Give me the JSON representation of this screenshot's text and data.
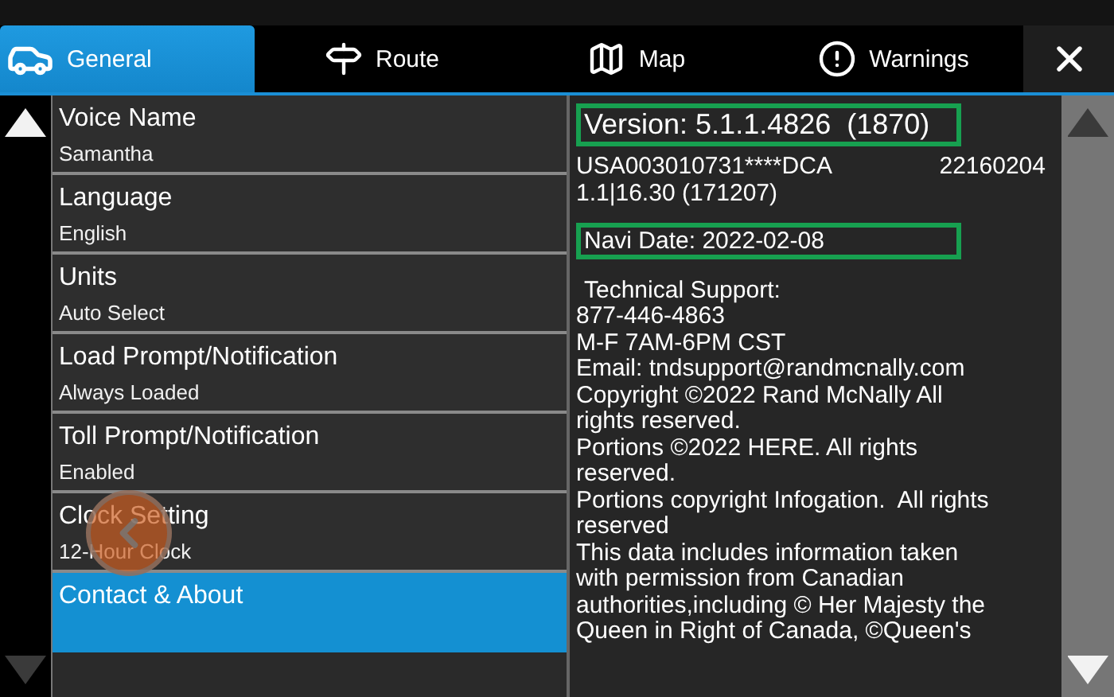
{
  "tabs": [
    {
      "label": "General",
      "kind": "car",
      "selected": true
    },
    {
      "label": "Route",
      "kind": "signpost",
      "selected": false
    },
    {
      "label": "Map",
      "kind": "map",
      "selected": false
    },
    {
      "label": "Warnings",
      "kind": "alert",
      "selected": false
    }
  ],
  "settings_scroll": {
    "up_disabled": false,
    "down_disabled": true
  },
  "settings": [
    {
      "title": "Voice Name",
      "value": "Samantha",
      "selected": false
    },
    {
      "title": "Language",
      "value": "English",
      "selected": false
    },
    {
      "title": "Units",
      "value": "Auto Select",
      "selected": false
    },
    {
      "title": "Load Prompt/Notification",
      "value": "Always Loaded",
      "selected": false
    },
    {
      "title": "Toll Prompt/Notification",
      "value": "Enabled",
      "selected": false
    },
    {
      "title": "Clock Setting",
      "value": "12-Hour Clock",
      "selected": false
    },
    {
      "title": "Contact & About",
      "selected": true
    }
  ],
  "about": {
    "version": {
      "text": "Version: 5.1.1.4826  (1870)",
      "highlighted": true
    },
    "map_id": "USA003010731****DCA",
    "map_code": "22160204",
    "map_build": "1.1|16.30 (171207)",
    "navi_date": {
      "text": "Navi Date: 2022-02-08",
      "highlighted": true
    },
    "lines": [
      "Technical Support:",
      "877-446-4863",
      "M-F 7AM-6PM CST",
      "Email: tndsupport@randmcnally.com",
      "Copyright ©2022 Rand McNally All rights reserved.",
      "Portions ©2022 HERE. All rights reserved.",
      "Portions copyright Infogation.  All rights reserved",
      "This data includes information taken with permission from Canadian authorities,including © Her Majesty the Queen in Right of Canada, ©Queen's"
    ]
  },
  "about_scroll": {
    "up_disabled": true,
    "down_disabled": false
  }
}
